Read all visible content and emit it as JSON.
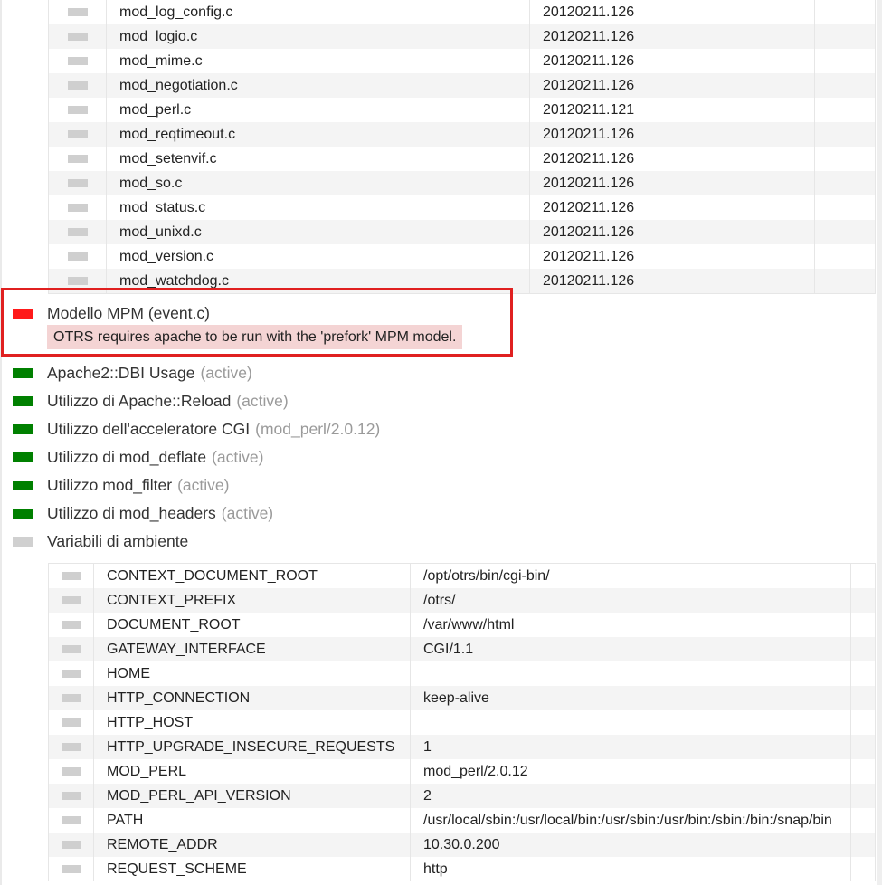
{
  "modules": [
    {
      "name": "mod_log_config.c",
      "version": "20120211.126"
    },
    {
      "name": "mod_logio.c",
      "version": "20120211.126"
    },
    {
      "name": "mod_mime.c",
      "version": "20120211.126"
    },
    {
      "name": "mod_negotiation.c",
      "version": "20120211.126"
    },
    {
      "name": "mod_perl.c",
      "version": "20120211.121"
    },
    {
      "name": "mod_reqtimeout.c",
      "version": "20120211.126"
    },
    {
      "name": "mod_setenvif.c",
      "version": "20120211.126"
    },
    {
      "name": "mod_so.c",
      "version": "20120211.126"
    },
    {
      "name": "mod_status.c",
      "version": "20120211.126"
    },
    {
      "name": "mod_unixd.c",
      "version": "20120211.126"
    },
    {
      "name": "mod_version.c",
      "version": "20120211.126"
    },
    {
      "name": "mod_watchdog.c",
      "version": "20120211.126"
    }
  ],
  "mpm_check": {
    "label": "Modello MPM",
    "value": "(event.c)",
    "status": "error",
    "message": "OTRS requires apache to be run with the 'prefork' MPM model."
  },
  "checks": [
    {
      "label": "Apache2::DBI Usage",
      "value": "(active)",
      "status": "ok"
    },
    {
      "label": "Utilizzo di Apache::Reload",
      "value": "(active)",
      "status": "ok"
    },
    {
      "label": "Utilizzo dell'acceleratore CGI",
      "value": "(mod_perl/2.0.12)",
      "status": "ok"
    },
    {
      "label": "Utilizzo di mod_deflate",
      "value": "(active)",
      "status": "ok"
    },
    {
      "label": "Utilizzo mod_filter",
      "value": "(active)",
      "status": "ok"
    },
    {
      "label": "Utilizzo di mod_headers",
      "value": "(active)",
      "status": "ok"
    }
  ],
  "env_section": {
    "label": "Variabili di ambiente",
    "status": "info"
  },
  "env_vars": [
    {
      "key": "CONTEXT_DOCUMENT_ROOT",
      "value": "/opt/otrs/bin/cgi-bin/"
    },
    {
      "key": "CONTEXT_PREFIX",
      "value": "/otrs/"
    },
    {
      "key": "DOCUMENT_ROOT",
      "value": "/var/www/html"
    },
    {
      "key": "GATEWAY_INTERFACE",
      "value": "CGI/1.1"
    },
    {
      "key": "HOME",
      "value": ""
    },
    {
      "key": "HTTP_CONNECTION",
      "value": "keep-alive"
    },
    {
      "key": "HTTP_HOST",
      "value": ""
    },
    {
      "key": "HTTP_UPGRADE_INSECURE_REQUESTS",
      "value": "1"
    },
    {
      "key": "MOD_PERL",
      "value": "mod_perl/2.0.12"
    },
    {
      "key": "MOD_PERL_API_VERSION",
      "value": "2"
    },
    {
      "key": "PATH",
      "value": "/usr/local/sbin:/usr/local/bin:/usr/sbin:/usr/bin:/sbin:/bin:/snap/bin"
    },
    {
      "key": "REMOTE_ADDR",
      "value": "10.30.0.200"
    },
    {
      "key": "REQUEST_SCHEME",
      "value": "http"
    }
  ],
  "colors": {
    "ok": "#008000",
    "error": "#ff1a1a",
    "info": "#d0d0d0",
    "highlight_border": "#e02020",
    "error_message_bg": "#f4d4d4"
  }
}
